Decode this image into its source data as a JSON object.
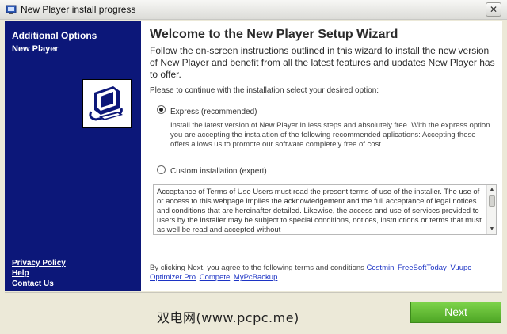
{
  "window": {
    "title": "New Player install progress",
    "close_glyph": "✕"
  },
  "sidebar": {
    "heading": "Additional Options",
    "subheading": "New Player",
    "logo_icon": "computer-installer-icon",
    "links": [
      {
        "label": "Privacy Policy"
      },
      {
        "label": "Help"
      },
      {
        "label": "Contact Us"
      }
    ]
  },
  "main": {
    "heading": "Welcome to the New Player Setup Wizard",
    "intro": "Follow the on-screen instructions outlined in this wizard to install the new version of New Player and benefit from all the latest features and updates New Player has to offer.",
    "prompt": "Please to continue with the installation select your desired option:",
    "options": {
      "express": {
        "label": "Express (recommended)",
        "selected": true,
        "description": "Install the latest version of New Player in less steps and absolutely free. With the express option you are accepting the instalation of the following recommended aplications: Accepting these offers allows us to promote our software completely free of cost."
      },
      "custom": {
        "label": "Custom installation (expert)",
        "selected": false
      }
    },
    "terms_text": "Acceptance of Terms of Use Users must read the present terms of use of the installer. The use of or access to this webpage implies the acknowledgement and the full acceptance of legal notices and conditions that are hereinafter detailed. Likewise, the access and use of services provided to users by the installer may be subject to special conditions, notices, instructions or terms that must as well be read and accepted without",
    "agreement": {
      "prefix": "By clicking Next, you agree to the following terms and conditions",
      "links": [
        {
          "label": "Costmin"
        },
        {
          "label": "FreeSoftToday"
        },
        {
          "label": "Vuupc Optimizer Pro"
        },
        {
          "label": "Compete"
        },
        {
          "label": "MyPcBackup"
        }
      ],
      "suffix": "."
    }
  },
  "footer": {
    "next_label": "Next",
    "watermark": "双电网(www.pcpc.me)"
  },
  "colors": {
    "sidebar_bg": "#0c1779",
    "link_blue": "#1c33c4",
    "next_green": "#5fb832"
  }
}
